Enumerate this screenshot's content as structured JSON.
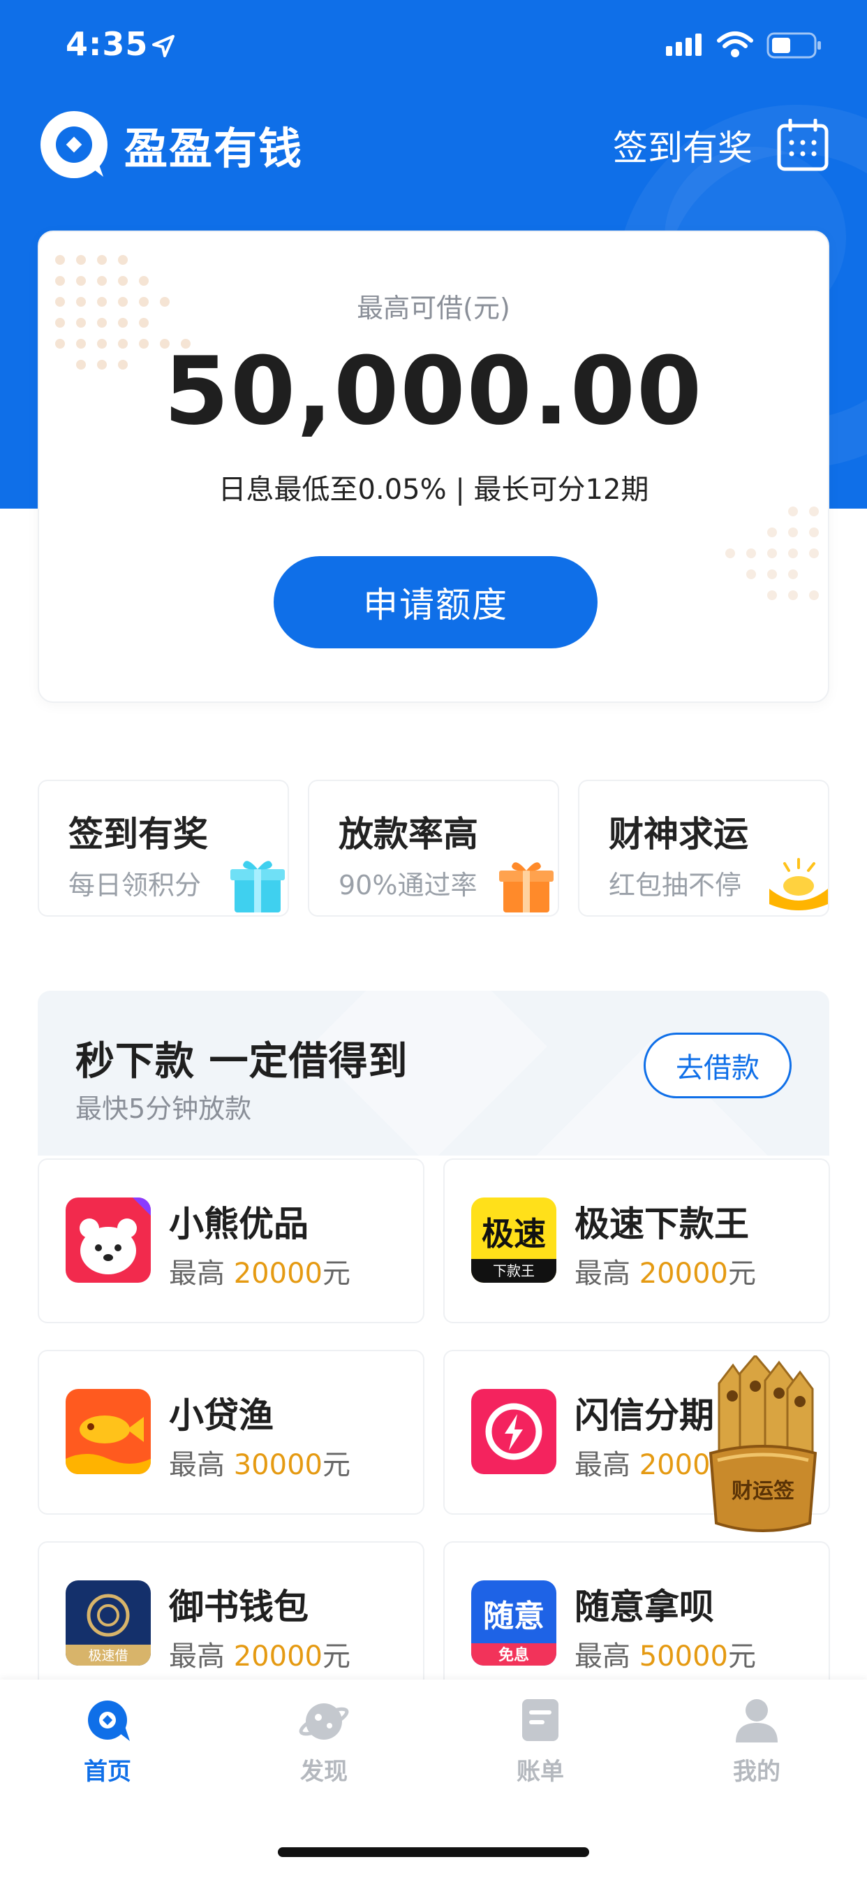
{
  "status_bar": {
    "time": "4:35"
  },
  "brand": {
    "name": "盈盈有钱",
    "checkin_label": "签到有奖"
  },
  "loan_card": {
    "caption": "最高可借(元)",
    "amount": "50,000.00",
    "rate_line": "日息最低至0.05% | 最长可分12期",
    "apply_label": "申请额度"
  },
  "features": [
    {
      "title": "签到有奖",
      "subtitle": "每日领积分",
      "icon": "gift-box-icon"
    },
    {
      "title": "放款率高",
      "subtitle": "90%通过率",
      "icon": "gift-orange-icon"
    },
    {
      "title": "财神求运",
      "subtitle": "红包抽不停",
      "icon": "gold-ingot-icon"
    }
  ],
  "promo": {
    "title": "秒下款 一定借得到",
    "subtitle": "最快5分钟放款",
    "button_label": "去借款"
  },
  "products": [
    {
      "name": "小熊优品",
      "prefix": "最高 ",
      "amount": "20000",
      "unit": "元",
      "icon": "bear-app-icon",
      "icon_text": ""
    },
    {
      "name": "极速下款王",
      "prefix": "最高 ",
      "amount": "20000",
      "unit": "元",
      "icon": "jisu-app-icon",
      "icon_text": "极速",
      "icon_subtext": "下款王"
    },
    {
      "name": "小贷渔",
      "prefix": "最高 ",
      "amount": "30000",
      "unit": "元",
      "icon": "fish-app-icon",
      "icon_text": ""
    },
    {
      "name": "闪信分期",
      "prefix": "最高 ",
      "amount": "20000",
      "unit": "元",
      "icon": "lightning-app-icon",
      "icon_text": ""
    },
    {
      "name": "御书钱包",
      "prefix": "最高 ",
      "amount": "20000",
      "unit": "元",
      "icon": "yushu-app-icon",
      "icon_text": "极速借"
    },
    {
      "name": "随意拿呗",
      "prefix": "最高 ",
      "amount": "50000",
      "unit": "元",
      "icon": "suiyi-app-icon",
      "icon_text": "随意",
      "icon_subtext": "免息"
    }
  ],
  "floating_deco": {
    "icon": "fortune-sticks-icon",
    "label": "财运签"
  },
  "tabbar": [
    {
      "label": "首页",
      "icon": "home-icon",
      "active": true
    },
    {
      "label": "发现",
      "icon": "discover-icon",
      "active": false
    },
    {
      "label": "账单",
      "icon": "bill-icon",
      "active": false
    },
    {
      "label": "我的",
      "icon": "profile-icon",
      "active": false
    }
  ],
  "colors": {
    "primary": "#0f6fe8",
    "amount_highlight": "#e59a12",
    "text_dark": "#1f1f1f",
    "text_muted": "#8a8f98"
  }
}
